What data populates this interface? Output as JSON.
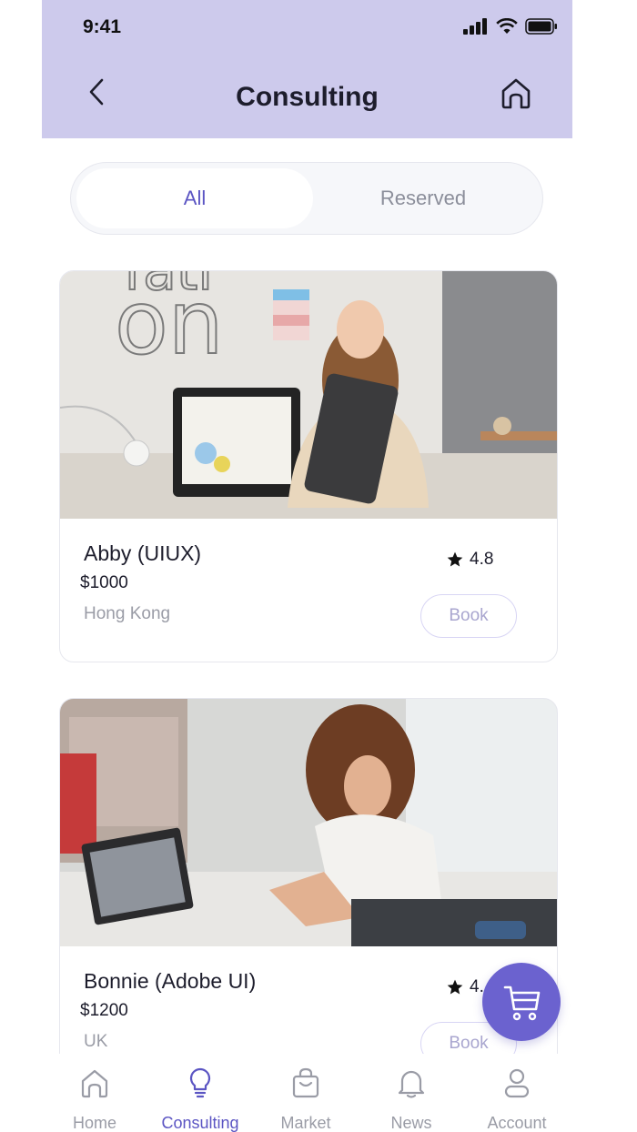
{
  "status": {
    "time": "9:41"
  },
  "header": {
    "title": "Consulting"
  },
  "segmented": {
    "all_label": "All",
    "reserved_label": "Reserved",
    "active": "All"
  },
  "consultants": [
    {
      "name": "Abby (UIUX)",
      "price": "$1000",
      "location": "Hong Kong",
      "rating": "4.8",
      "book_label": "Book"
    },
    {
      "name": "Bonnie (Adobe UI)",
      "price": "$1200",
      "location": "UK",
      "rating": "4.",
      "book_label": "Book"
    }
  ],
  "tabs": [
    {
      "label": "Home",
      "icon": "home-icon"
    },
    {
      "label": "Consulting",
      "icon": "lightbulb-icon"
    },
    {
      "label": "Market",
      "icon": "shopping-bag-icon"
    },
    {
      "label": "News",
      "icon": "bell-icon"
    },
    {
      "label": "Account",
      "icon": "user-icon"
    }
  ],
  "colors": {
    "header_bg": "#cdcaec",
    "accent": "#5b55c3",
    "fab": "#6b62cf"
  }
}
